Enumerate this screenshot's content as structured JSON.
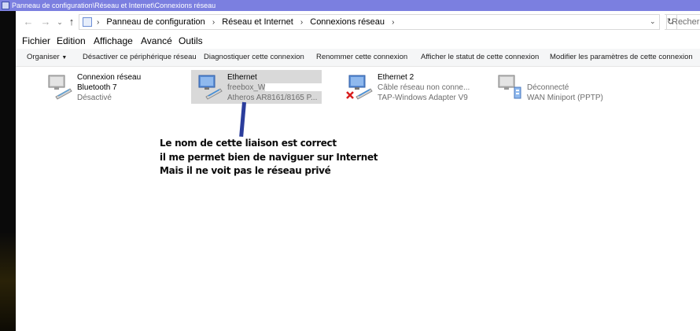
{
  "window": {
    "title": "Panneau de configuration\\Réseau et Internet\\Connexions réseau"
  },
  "address": {
    "crumbs": [
      "Panneau de configuration",
      "Réseau et Internet",
      "Connexions réseau"
    ],
    "search_placeholder": "Rechercher"
  },
  "menu": [
    "Fichier",
    "Edition",
    "Affichage",
    "Avancé",
    "Outils"
  ],
  "commands": {
    "organize": "Organiser",
    "disable": "Désactiver ce périphérique réseau",
    "diagnose": "Diagnostiquer cette connexion",
    "rename": "Renommer cette connexion",
    "status": "Afficher le statut de cette connexion",
    "modify": "Modifier les paramètres de cette connexion"
  },
  "connections": [
    {
      "line1": "Connexion réseau",
      "line2": "Bluetooth 7",
      "line3": "Désactivé",
      "icon": "network-adapter-icon"
    },
    {
      "line1": "Ethernet",
      "line2": "freebox_W",
      "line3": "Atheros AR8161/8165 P...",
      "icon": "network-adapter-icon"
    },
    {
      "line1": "Ethernet 2",
      "line2": "Câble réseau non conne...",
      "line3": "TAP-Windows Adapter V9",
      "icon": "network-disconnected-icon"
    },
    {
      "line1": "",
      "line2": "Déconnecté",
      "line3": "WAN Miniport (PPTP)",
      "icon": "wan-adapter-icon"
    }
  ],
  "annotation": [
    "Le nom de cette liaison est correct",
    "il me permet bien de naviguer sur Internet",
    "Mais il ne voit pas le réseau privé"
  ],
  "colors": {
    "titlebar": "#7b7fe0",
    "selection": "#d9d9d9",
    "annotation_line": "#2b3d9c"
  }
}
